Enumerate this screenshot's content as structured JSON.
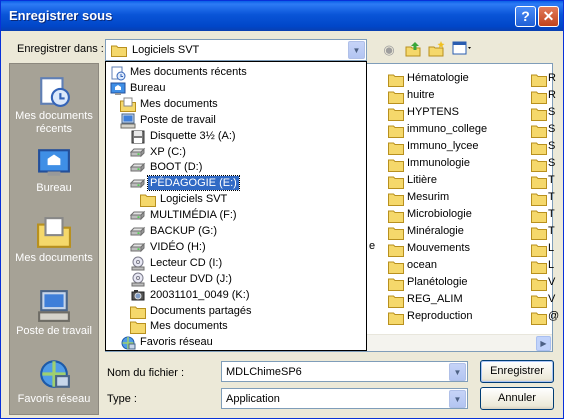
{
  "window": {
    "title": "Enregistrer sous"
  },
  "title_buttons": {
    "help": "?",
    "close": "✕"
  },
  "save_in": {
    "label": "Enregistrer dans :",
    "value": "Logiciels SVT"
  },
  "toolbar": [
    "back-icon",
    "up-folder-icon",
    "new-folder-icon",
    "view-menu-icon"
  ],
  "places": [
    {
      "label": "Mes documents récents",
      "icon": "recent-documents-icon"
    },
    {
      "label": "Bureau",
      "icon": "desktop-icon"
    },
    {
      "label": "Mes documents",
      "icon": "my-documents-icon"
    },
    {
      "label": "Poste de travail",
      "icon": "my-computer-icon"
    },
    {
      "label": "Favoris réseau",
      "icon": "network-places-icon"
    }
  ],
  "dropdown_items": [
    {
      "label": "Mes documents récents",
      "icon": "recent-documents-icon",
      "indent": 0
    },
    {
      "label": "Bureau",
      "icon": "desktop-icon",
      "indent": 0
    },
    {
      "label": "Mes documents",
      "icon": "my-documents-icon",
      "indent": 1
    },
    {
      "label": "Poste de travail",
      "icon": "my-computer-icon",
      "indent": 1
    },
    {
      "label": "Disquette 3½ (A:)",
      "icon": "floppy-icon",
      "indent": 2
    },
    {
      "label": "XP (C:)",
      "icon": "drive-icon",
      "indent": 2
    },
    {
      "label": "BOOT (D:)",
      "icon": "drive-icon",
      "indent": 2
    },
    {
      "label": "PÉDAGOGIE (E:)",
      "icon": "drive-icon",
      "indent": 2,
      "selected": true
    },
    {
      "label": "Logiciels SVT",
      "icon": "folder-icon",
      "indent": 3
    },
    {
      "label": "MULTIMÉDIA (F:)",
      "icon": "drive-icon",
      "indent": 2
    },
    {
      "label": "BACKUP (G:)",
      "icon": "drive-icon",
      "indent": 2
    },
    {
      "label": "VIDÉO (H:)",
      "icon": "drive-icon",
      "indent": 2
    },
    {
      "label": "Lecteur CD (I:)",
      "icon": "cd-drive-icon",
      "indent": 2
    },
    {
      "label": "Lecteur DVD (J:)",
      "icon": "cd-drive-icon",
      "indent": 2
    },
    {
      "label": "20031101_0049 (K:)",
      "icon": "camera-drive-icon",
      "indent": 2
    },
    {
      "label": "Documents partagés",
      "icon": "folder-icon",
      "indent": 2
    },
    {
      "label": "Mes documents",
      "icon": "folder-icon",
      "indent": 2
    },
    {
      "label": "Favoris réseau",
      "icon": "network-places-icon",
      "indent": 1
    }
  ],
  "file_list": {
    "column1": [
      "Hématologie",
      "huitre",
      "HYPTENS",
      "immuno_college",
      "Immuno_lycee",
      "Immunologie",
      "Litière",
      "Mesurim",
      "Microbiologie",
      "Minéralogie",
      "Mouvements",
      "ocean",
      "Planétologie",
      "REG_ALIM",
      "Reproduction"
    ],
    "column2": [
      "R",
      "R",
      "S",
      "S",
      "S",
      "S",
      "T",
      "T",
      "T",
      "T",
      "L",
      "L",
      "V",
      "V",
      "@"
    ],
    "partial_text": "e"
  },
  "filename": {
    "label": "Nom du fichier :",
    "value": "MDLChimeSP6"
  },
  "filetype": {
    "label": "Type :",
    "value": "Application"
  },
  "buttons": {
    "save": "Enregistrer",
    "cancel": "Annuler"
  },
  "colors": {
    "titlebar": "#0a55d8",
    "selection": "#316ac5",
    "dialog_bg": "#ece9d8",
    "folder": "#f5d86b"
  }
}
